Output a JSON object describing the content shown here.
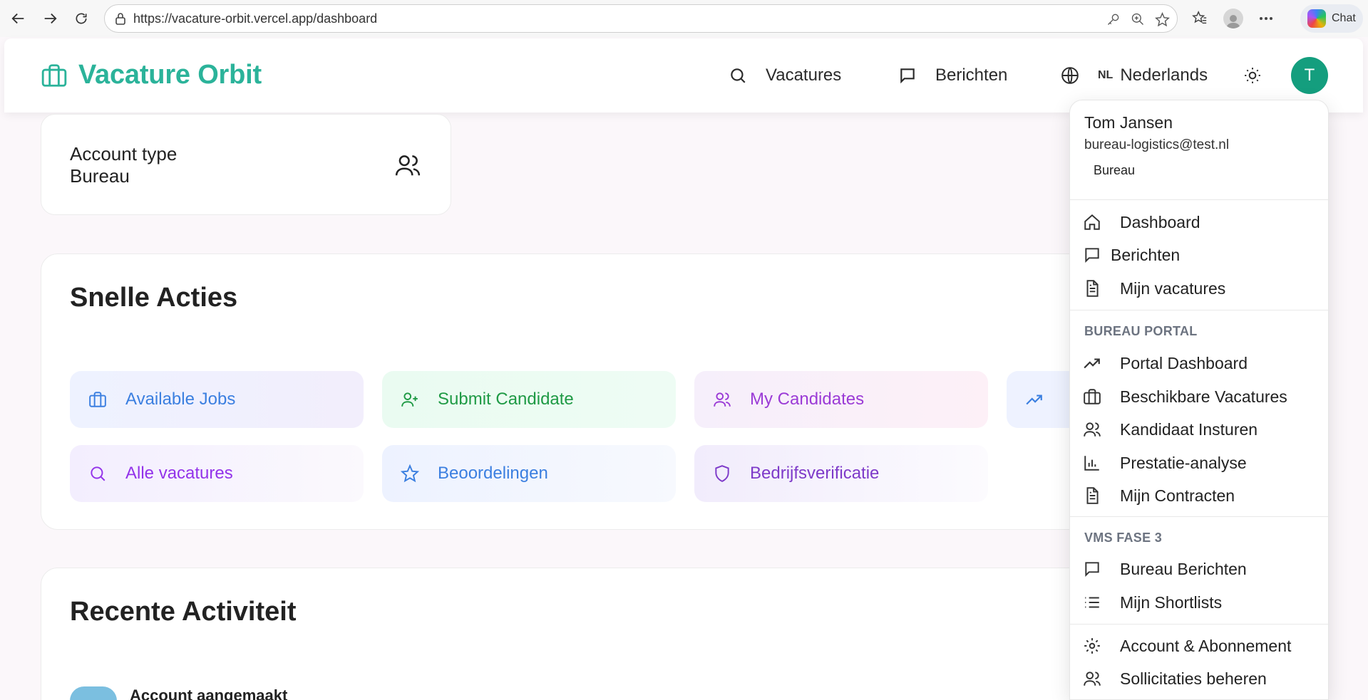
{
  "browser": {
    "url": "https://vacature-orbit.vercel.app/dashboard",
    "chat_label": "Chat"
  },
  "header": {
    "logo_text": "Vacature Orbit",
    "nav_vacatures": "Vacatures",
    "nav_berichten": "Berichten",
    "lang_code": "NL",
    "lang_label": "Nederlands",
    "avatar_initial": "T"
  },
  "account": {
    "label": "Account type",
    "value": "Bureau"
  },
  "quick_actions": {
    "title": "Snelle Acties",
    "items": [
      {
        "label": "Available Jobs",
        "icon": "briefcase-icon",
        "color": "#3b82f6",
        "bg": "#edf2ff"
      },
      {
        "label": "Submit Candidate",
        "icon": "user-plus-icon",
        "color": "#16a34a",
        "bg": "#ebfbf1"
      },
      {
        "label": "My Candidates",
        "icon": "users-icon",
        "color": "#9333ea",
        "bg": "#f9effa"
      },
      {
        "label": "Alle vacatures",
        "icon": "search-icon",
        "color": "#9333ea",
        "bg": "#f3efff"
      },
      {
        "label": "Beoordelingen",
        "icon": "star-icon",
        "color": "#3b82f6",
        "bg": "#eef3ff"
      },
      {
        "label": "Bedrijfsverificatie",
        "icon": "shield-icon",
        "color": "#7e3ac9",
        "bg": "#f1ecfc"
      }
    ]
  },
  "recent": {
    "title": "Recente Activiteit",
    "first_item": "Account aangemaakt"
  },
  "dropdown": {
    "name": "Tom Jansen",
    "email": "bureau-logistics@test.nl",
    "role": "Bureau",
    "main_items": [
      "Dashboard",
      "Berichten",
      "Mijn vacatures"
    ],
    "section_portal": "BUREAU PORTAL",
    "portal_items": [
      "Portal Dashboard",
      "Beschikbare Vacatures",
      "Kandidaat Insturen",
      "Prestatie-analyse",
      "Mijn Contracten"
    ],
    "section_vms": "VMS FASE 3",
    "vms_items": [
      "Bureau Berichten",
      "Mijn Shortlists"
    ],
    "account_items": [
      "Account & Abonnement",
      "Sollicitaties beheren"
    ]
  }
}
